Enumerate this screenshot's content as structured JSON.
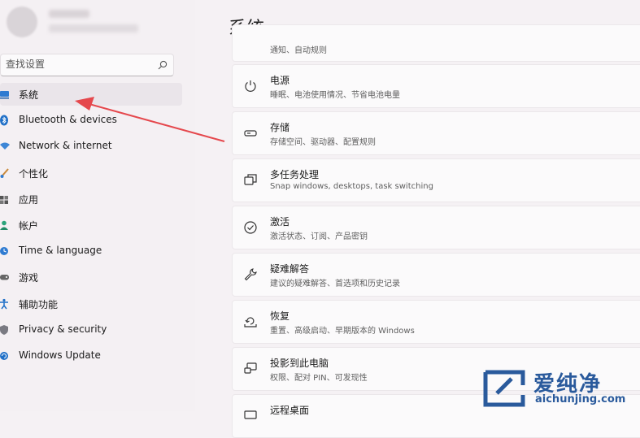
{
  "sidebar": {
    "search": {
      "placeholder": "查找设置"
    },
    "items": [
      {
        "label": "系统",
        "icon": "monitor-icon",
        "active": true
      },
      {
        "label": "Bluetooth & devices",
        "icon": "bluetooth-icon"
      },
      {
        "label": "Network & internet",
        "icon": "wifi-icon"
      },
      {
        "label": "个性化",
        "icon": "brush-icon"
      },
      {
        "label": "应用",
        "icon": "apps-icon"
      },
      {
        "label": "帐户",
        "icon": "person-icon"
      },
      {
        "label": "Time & language",
        "icon": "globe-clock-icon"
      },
      {
        "label": "游戏",
        "icon": "gamepad-icon"
      },
      {
        "label": "辅助功能",
        "icon": "accessibility-icon"
      },
      {
        "label": "Privacy & security",
        "icon": "shield-icon"
      },
      {
        "label": "Windows Update",
        "icon": "update-icon"
      }
    ]
  },
  "main": {
    "title": "系统",
    "partial_top_subtitle": "通知、自动规则",
    "cards": [
      {
        "title": "电源",
        "subtitle": "睡眠、电池使用情况、节省电池电量",
        "icon": "power-icon"
      },
      {
        "title": "存储",
        "subtitle": "存储空间、驱动器、配置规则",
        "icon": "storage-icon"
      },
      {
        "title": "多任务处理",
        "subtitle": "Snap windows, desktops, task switching",
        "icon": "multitask-icon"
      },
      {
        "title": "激活",
        "subtitle": "激活状态、订阅、产品密钥",
        "icon": "check-circle-icon"
      },
      {
        "title": "疑难解答",
        "subtitle": "建议的疑难解答、首选项和历史记录",
        "icon": "wrench-icon"
      },
      {
        "title": "恢复",
        "subtitle": "重置、高级启动、早期版本的 Windows",
        "icon": "recovery-icon"
      },
      {
        "title": "投影到此电脑",
        "subtitle": "权限、配对 PIN、可发现性",
        "icon": "project-icon"
      },
      {
        "title": "远程桌面",
        "subtitle": "",
        "icon": "remote-desktop-icon"
      }
    ]
  },
  "watermark": {
    "text": "爱纯净",
    "url": "aichunjing.com"
  },
  "colors": {
    "accent": "#0067c0",
    "arrow": "#e5484d",
    "watermark": "#2a5a9c"
  }
}
